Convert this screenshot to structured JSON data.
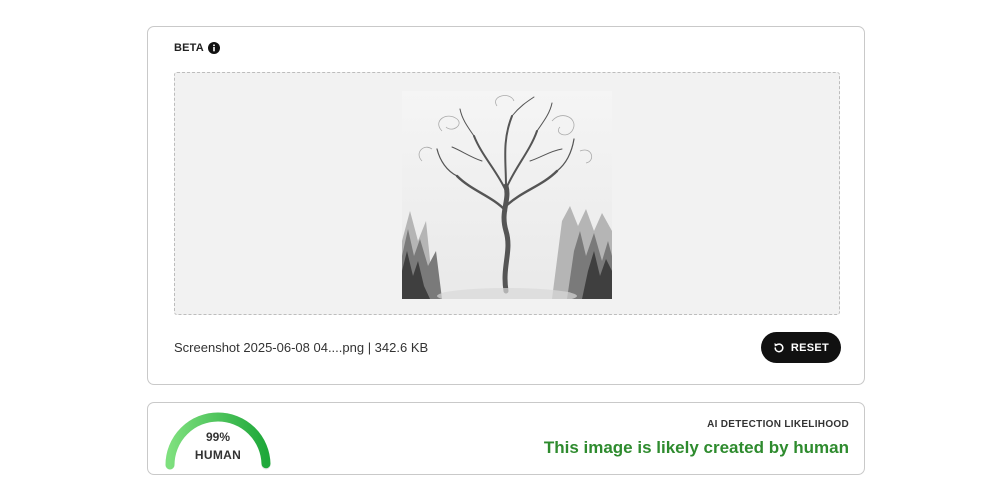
{
  "upload": {
    "badge": "BETA",
    "info_icon": "info-icon",
    "preview_alt": "Uploaded image preview",
    "file_name": "Screenshot 2025-06-08 04....png",
    "file_size": "342.6 KB",
    "file_info": "Screenshot 2025-06-08 04....png | 342.6 KB",
    "reset_label": "RESET",
    "reset_icon": "reset-icon"
  },
  "result": {
    "gauge_percent": "99%",
    "gauge_value": 0.99,
    "gauge_label": "HUMAN",
    "heading": "AI DETECTION LIKELIHOOD",
    "verdict": "This image is likely created by human",
    "colors": {
      "gauge_start": "#7ee07e",
      "gauge_end": "#1fa83a",
      "verdict": "#2e8b2e"
    }
  }
}
